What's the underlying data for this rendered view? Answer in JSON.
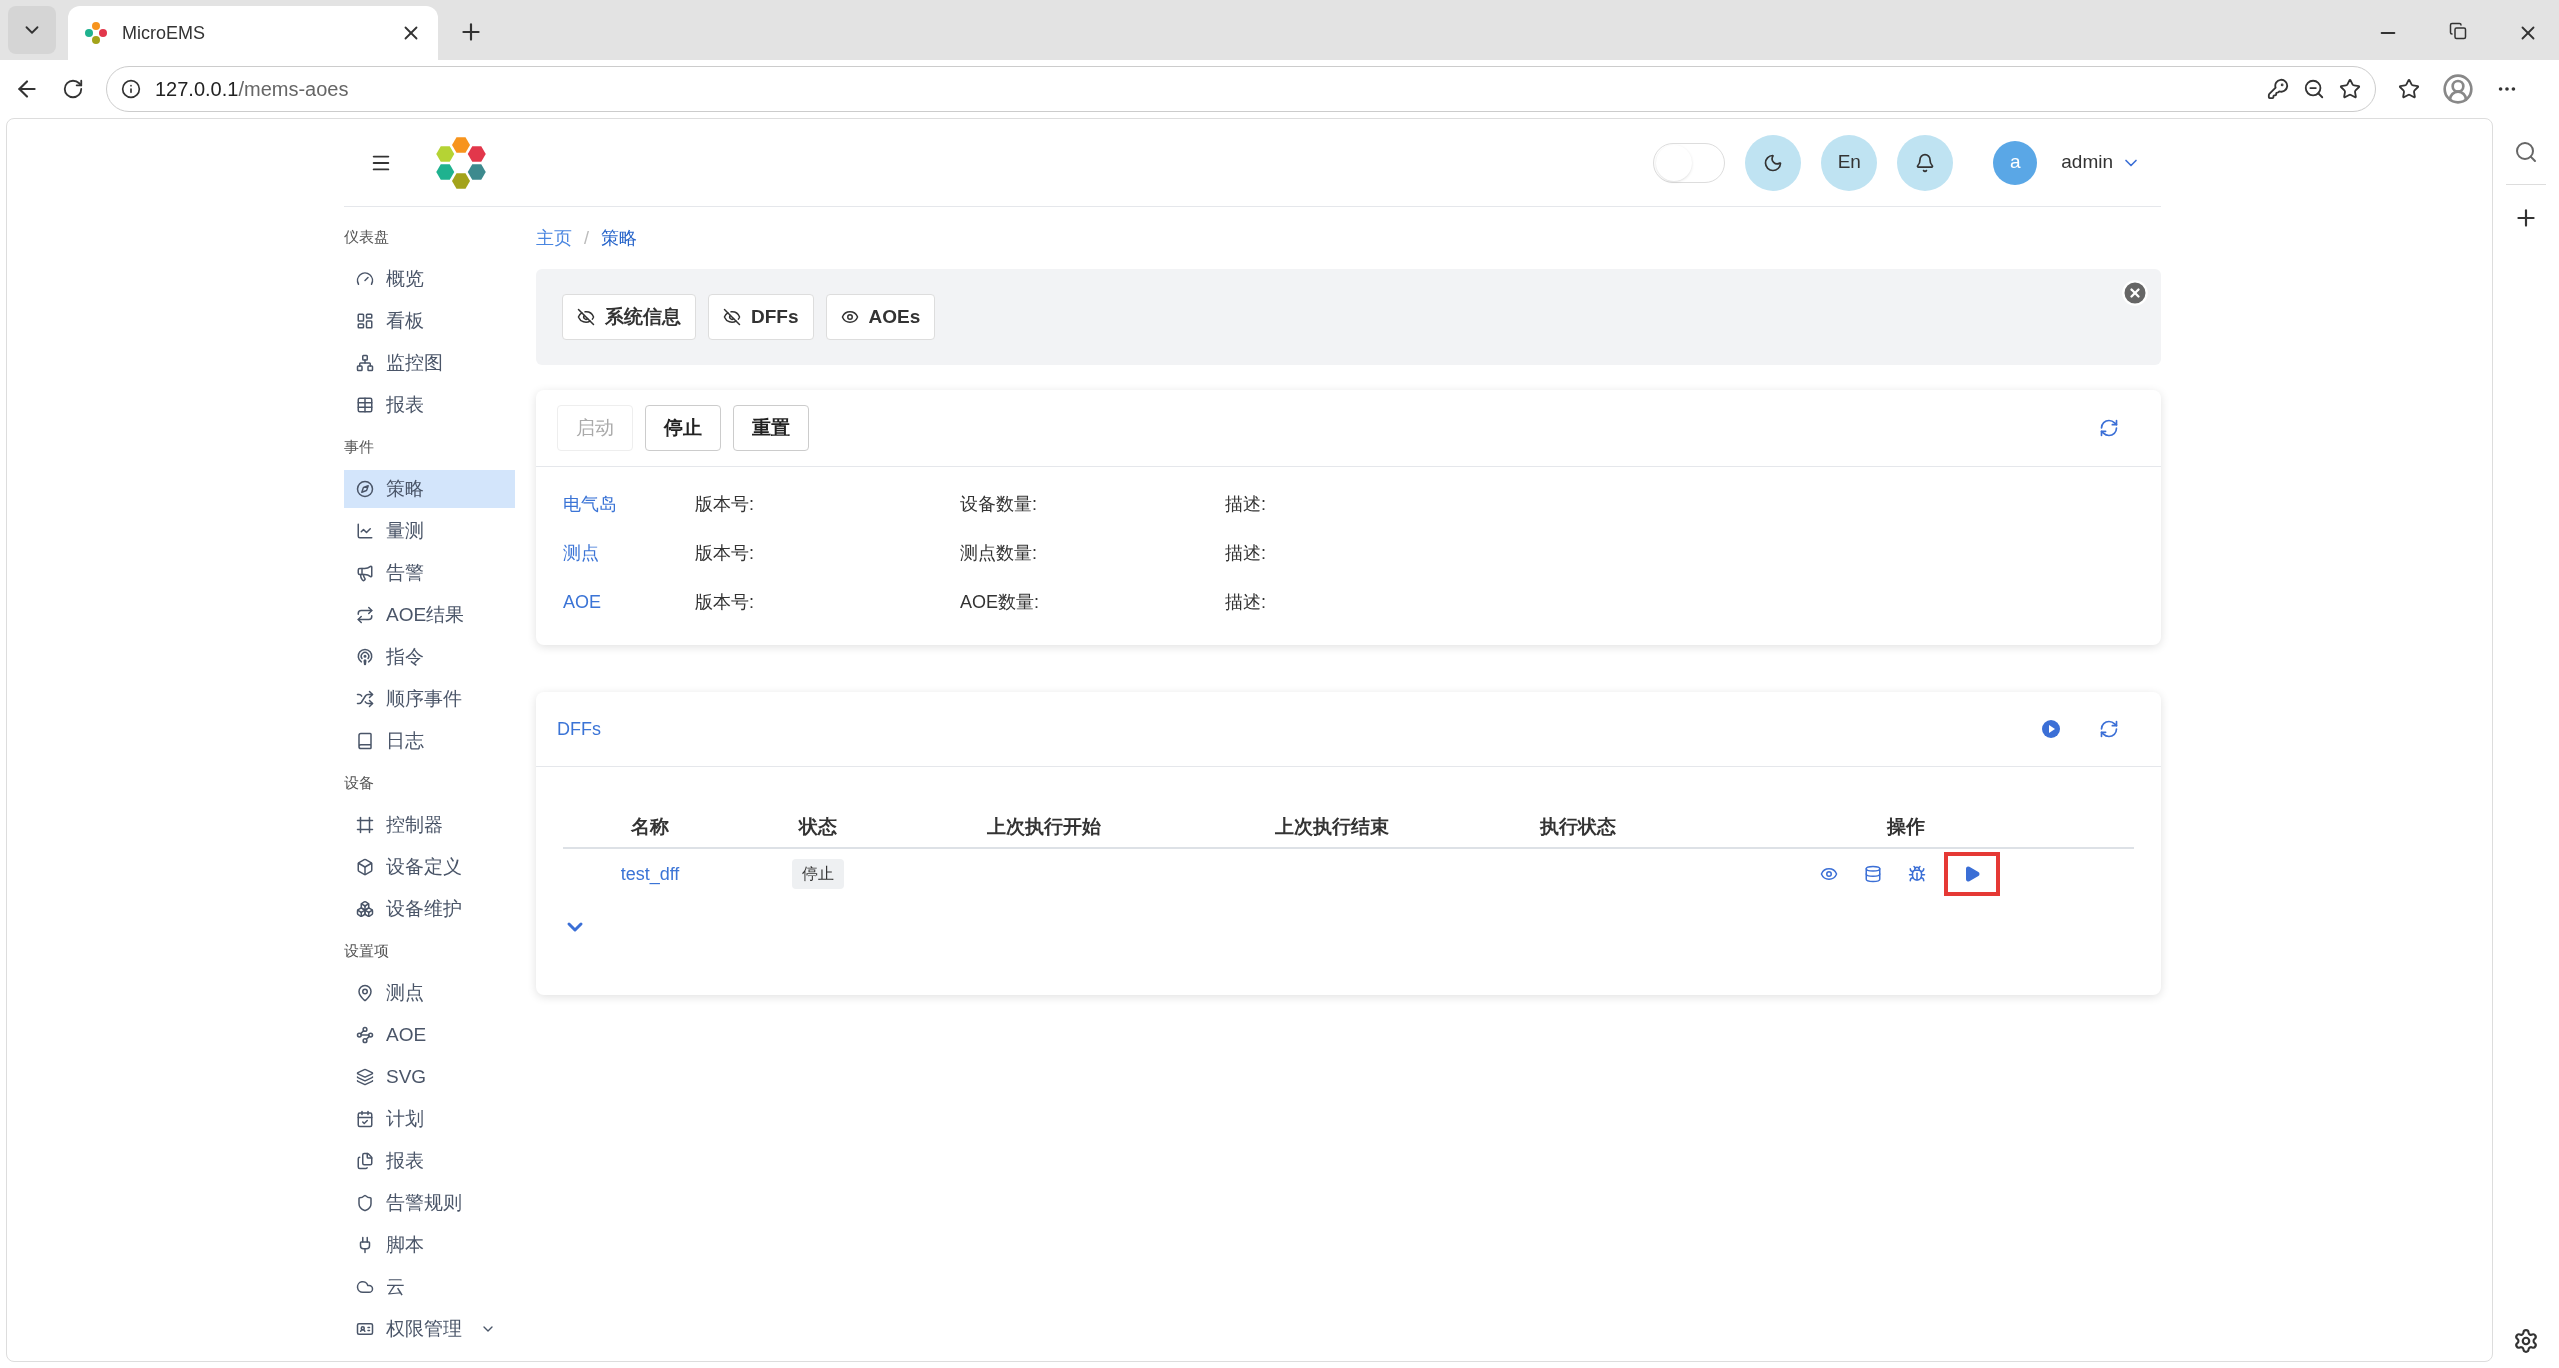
{
  "browser": {
    "tab_title": "MicroEMS",
    "url_host": "127.0.0.1",
    "url_path": "/mems-aoes"
  },
  "header": {
    "theme_toggle_on": false,
    "language": "En",
    "user_initial": "a",
    "user_name": "admin"
  },
  "sidebar": [
    {
      "heading": "仪表盘",
      "items": [
        {
          "label": "概览",
          "selected": false,
          "kind": "link"
        },
        {
          "label": "看板",
          "selected": false,
          "kind": "link"
        },
        {
          "label": "监控图",
          "selected": false,
          "kind": "link"
        },
        {
          "label": "报表",
          "selected": false,
          "kind": "link"
        }
      ]
    },
    {
      "heading": "事件",
      "items": [
        {
          "label": "策略",
          "selected": true,
          "kind": "link"
        },
        {
          "label": "量测",
          "selected": false,
          "kind": "link"
        },
        {
          "label": "告警",
          "selected": false,
          "kind": "link"
        },
        {
          "label": "AOE结果",
          "selected": false,
          "kind": "link"
        },
        {
          "label": "指令",
          "selected": false,
          "kind": "link"
        },
        {
          "label": "顺序事件",
          "selected": false,
          "kind": "link"
        },
        {
          "label": "日志",
          "selected": false,
          "kind": "link"
        }
      ]
    },
    {
      "heading": "设备",
      "items": [
        {
          "label": "控制器",
          "selected": false,
          "kind": "link"
        },
        {
          "label": "设备定义",
          "selected": false,
          "kind": "link"
        },
        {
          "label": "设备维护",
          "selected": false,
          "kind": "link"
        }
      ]
    },
    {
      "heading": "设置项",
      "items": [
        {
          "label": "测点",
          "selected": false,
          "kind": "link"
        },
        {
          "label": "AOE",
          "selected": false,
          "kind": "link"
        },
        {
          "label": "SVG",
          "selected": false,
          "kind": "link"
        },
        {
          "label": "计划",
          "selected": false,
          "kind": "link"
        },
        {
          "label": "报表",
          "selected": false,
          "kind": "link"
        },
        {
          "label": "告警规则",
          "selected": false,
          "kind": "link"
        },
        {
          "label": "脚本",
          "selected": false,
          "kind": "link"
        },
        {
          "label": "云",
          "selected": false,
          "kind": "link"
        },
        {
          "label": "权限管理",
          "selected": false,
          "kind": "group"
        }
      ]
    }
  ],
  "breadcrumb": {
    "items": [
      "主页",
      "策略"
    ],
    "separator": "/"
  },
  "panel_toggles": [
    {
      "label": "系统信息",
      "visible": false
    },
    {
      "label": "DFFs",
      "visible": false
    },
    {
      "label": "AOEs",
      "visible": true
    }
  ],
  "controls": [
    {
      "label": "启动",
      "disabled": true
    },
    {
      "label": "停止",
      "disabled": false
    },
    {
      "label": "重置",
      "disabled": false
    }
  ],
  "info_rows": [
    {
      "name": "电气岛",
      "version_label": "版本号:",
      "count_label": "设备数量:",
      "description_label": "描述:"
    },
    {
      "name": "测点",
      "version_label": "版本号:",
      "count_label": "测点数量:",
      "description_label": "描述:"
    },
    {
      "name": "AOE",
      "version_label": "版本号:",
      "count_label": "AOE数量:",
      "description_label": "描述:"
    }
  ],
  "dff_card": {
    "title": "DFFs",
    "columns": [
      "名称",
      "状态",
      "上次执行开始",
      "上次执行结束",
      "执行状态",
      "操作"
    ],
    "rows": [
      {
        "name": "test_dff",
        "status": "停止",
        "actions": [
          {
            "highlighted": false
          },
          {
            "highlighted": false
          },
          {
            "highlighted": false
          },
          {
            "highlighted": true
          }
        ]
      }
    ]
  }
}
